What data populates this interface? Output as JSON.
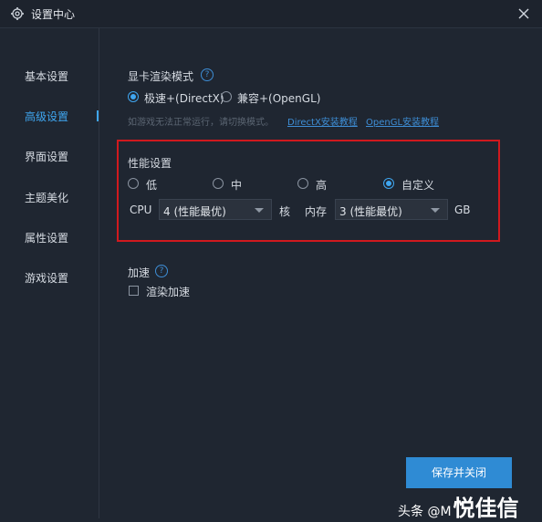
{
  "window": {
    "title": "设置中心",
    "icon": "gear-icon",
    "close_icon": "close-icon"
  },
  "sidebar": {
    "items": [
      {
        "label": "基本设置",
        "active": false
      },
      {
        "label": "高级设置",
        "active": true
      },
      {
        "label": "界面设置",
        "active": false
      },
      {
        "label": "主题美化",
        "active": false
      },
      {
        "label": "属性设置",
        "active": false
      },
      {
        "label": "游戏设置",
        "active": false
      }
    ]
  },
  "render": {
    "title": "显卡渲染模式",
    "help": "?",
    "options": [
      {
        "label": "极速+(DirectX)",
        "selected": true
      },
      {
        "label": "兼容+(OpenGL)",
        "selected": false
      }
    ],
    "hint": "如游戏无法正常运行，请切换模式。",
    "links": [
      "DirectX安装教程",
      "OpenGL安装教程"
    ]
  },
  "performance": {
    "title": "性能设置",
    "levels": [
      {
        "label": "低",
        "selected": false
      },
      {
        "label": "中",
        "selected": false
      },
      {
        "label": "高",
        "selected": false
      },
      {
        "label": "自定义",
        "selected": true
      }
    ],
    "cpu_label": "CPU",
    "cpu_value": "4 (性能最优)",
    "cpu_unit": "核",
    "mem_label": "内存",
    "mem_value": "3 (性能最优)",
    "mem_unit": "GB"
  },
  "accel": {
    "title": "加速",
    "help": "?",
    "checkbox_label": "渲染加速",
    "checked": false
  },
  "footer": {
    "save_label": "保存并关闭"
  },
  "watermark": {
    "prefix": "头条 @M",
    "brand": "悦佳信"
  },
  "colors": {
    "background": "#1f2631",
    "accent": "#3fa6f0",
    "link": "#3e8ed6",
    "highlight_box": "#d0191e",
    "button": "#2f8bd4"
  }
}
